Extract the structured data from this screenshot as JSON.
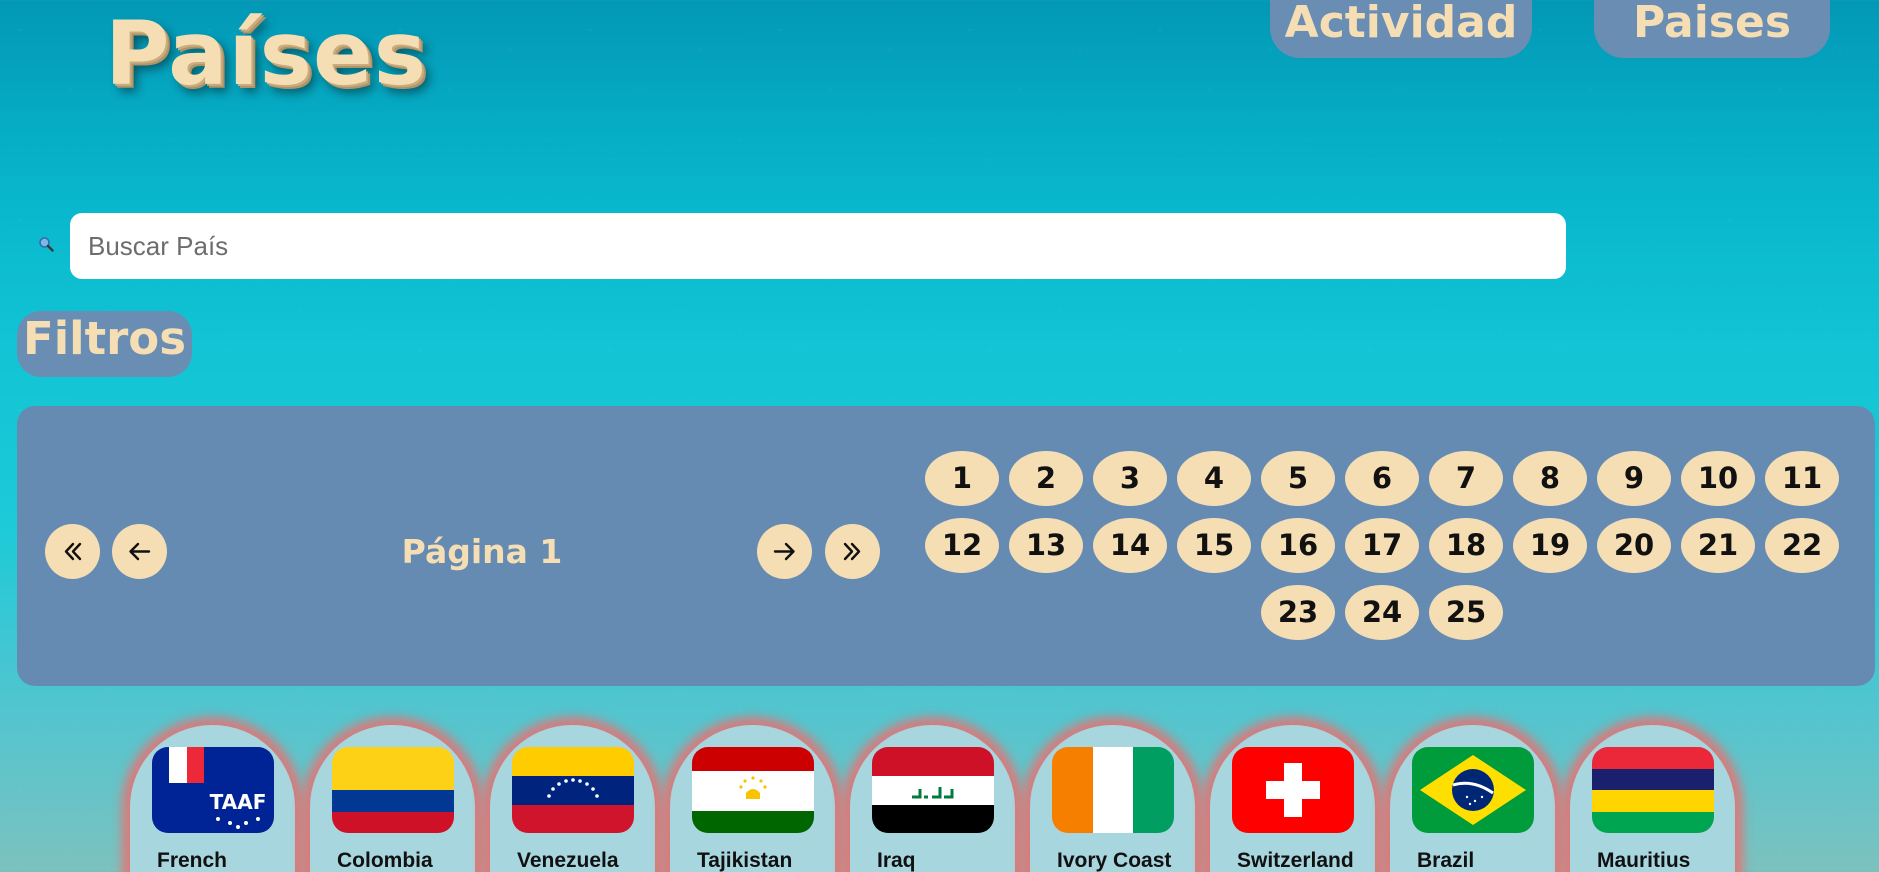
{
  "header": {
    "title": "Países",
    "nav": {
      "actividad_label": "Actividad",
      "paises_label": "Paises"
    }
  },
  "search": {
    "placeholder": "Buscar País",
    "value": ""
  },
  "filters": {
    "label": "Filtros"
  },
  "pagination": {
    "current_label": "Página 1",
    "first_icon": "double-chevron-left-icon",
    "prev_icon": "arrow-left-icon",
    "next_icon": "arrow-right-icon",
    "last_icon": "double-chevron-right-icon",
    "pages": [
      "1",
      "2",
      "3",
      "4",
      "5",
      "6",
      "7",
      "8",
      "9",
      "10",
      "11",
      "12",
      "13",
      "14",
      "15",
      "16",
      "17",
      "18",
      "19",
      "20",
      "21",
      "22",
      "23",
      "24",
      "25"
    ]
  },
  "countries": [
    {
      "name": "French",
      "flag": "french-southern-territories-flag"
    },
    {
      "name": "Colombia",
      "flag": "colombia-flag"
    },
    {
      "name": "Venezuela",
      "flag": "venezuela-flag"
    },
    {
      "name": "Tajikistan",
      "flag": "tajikistan-flag"
    },
    {
      "name": "Iraq",
      "flag": "iraq-flag"
    },
    {
      "name": "Ivory Coast",
      "flag": "ivory-coast-flag"
    },
    {
      "name": "Switzerland",
      "flag": "switzerland-flag"
    },
    {
      "name": "Brazil",
      "flag": "brazil-flag"
    },
    {
      "name": "Mauritius",
      "flag": "mauritius-flag"
    }
  ],
  "colors": {
    "accent": "#f5deb3",
    "panel": "#658bb3",
    "card": "#a8d6df",
    "card_glow": "#ec6e6e"
  }
}
